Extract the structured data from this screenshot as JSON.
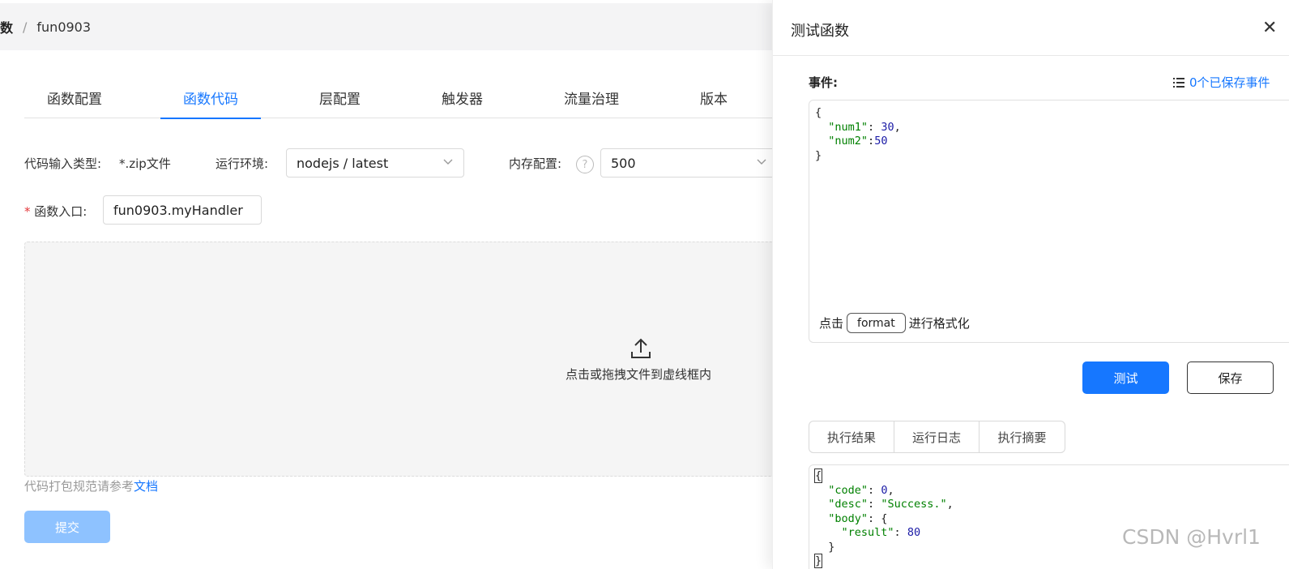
{
  "breadcrumb": {
    "prev": "数",
    "separator": "/",
    "current": "fun0903"
  },
  "tabs": [
    {
      "label": "函数配置"
    },
    {
      "label": "函数代码"
    },
    {
      "label": "层配置"
    },
    {
      "label": "触发器"
    },
    {
      "label": "流量治理"
    },
    {
      "label": "版本"
    }
  ],
  "active_tab": "函数代码",
  "form": {
    "code_type_label": "代码输入类型:",
    "code_type_value": "*.zip文件",
    "runtime_label": "运行环境:",
    "runtime_value": "nodejs / latest",
    "memory_label": "内存配置:",
    "memory_value": "500",
    "entry_required_mark": "*",
    "entry_label": "函数入口:",
    "entry_value": "fun0903.myHandler"
  },
  "upload": {
    "icon": "upload-icon",
    "text": "点击或拖拽文件到虚线框内",
    "hint_prefix": "代码打包规范请参考",
    "hint_link": "文档"
  },
  "submit_label": "提交",
  "drawer": {
    "title": "测试函数",
    "close_icon": "close-icon",
    "event_label": "事件:",
    "saved_events": "0个已保存事件",
    "event_code": {
      "line1": "{",
      "key1": "\"num1\"",
      "val1": "30",
      "key2": "\"num2\"",
      "val2": "50",
      "line_end": "}"
    },
    "format_prefix": "点击",
    "format_button": "format",
    "format_suffix": "进行格式化",
    "test_button": "测试",
    "save_button": "保存",
    "result_tabs": [
      "执行结果",
      "运行日志",
      "执行摘要"
    ],
    "result_code": {
      "open": "{",
      "k_code": "\"code\"",
      "v_code": "0",
      "k_desc": "\"desc\"",
      "v_desc": "\"Success.\"",
      "k_body": "\"body\"",
      "k_result": "\"result\"",
      "v_result": "80",
      "inner_close": "}",
      "close": "}"
    }
  },
  "watermark": "CSDN @Hvrl1",
  "colors": {
    "accent": "#1677ff",
    "submit_disabled": "#8ec2ff",
    "json_key": "#008000",
    "json_number": "#1a1aa6"
  }
}
